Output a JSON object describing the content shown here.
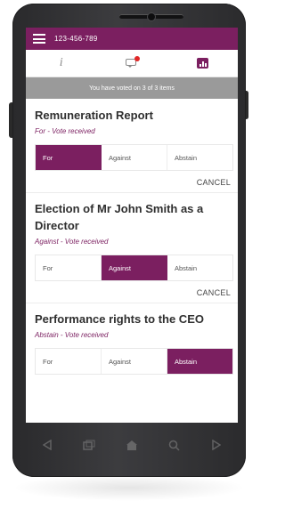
{
  "app": {
    "phone_number": "123-456-789"
  },
  "icons": {
    "menu": "hamburger-icon",
    "info": "info-icon",
    "info_glyph": "i",
    "messages": "chat-icon",
    "results": "chart-icon"
  },
  "colors": {
    "brand": "#7b1f60",
    "banner": "#9a9a9a",
    "notification": "#e12727"
  },
  "vote_banner": "You have voted on 3 of 3 items",
  "resolutions": [
    {
      "title": "Remuneration Report",
      "status": "For - Vote received",
      "options": [
        "For",
        "Against",
        "Abstain"
      ],
      "selected": "For",
      "cancel_label": "CANCEL"
    },
    {
      "title": "Election of Mr John Smith as a Director",
      "status": "Against - Vote received",
      "options": [
        "For",
        "Against",
        "Abstain"
      ],
      "selected": "Against",
      "cancel_label": "CANCEL"
    },
    {
      "title": "Performance rights to the CEO",
      "status": "Abstain - Vote received",
      "options": [
        "For",
        "Against",
        "Abstain"
      ],
      "selected": "Abstain",
      "cancel_label": ""
    }
  ],
  "navbar": [
    "back-icon",
    "recent-apps-icon",
    "home-icon",
    "search-icon",
    "forward-icon"
  ]
}
